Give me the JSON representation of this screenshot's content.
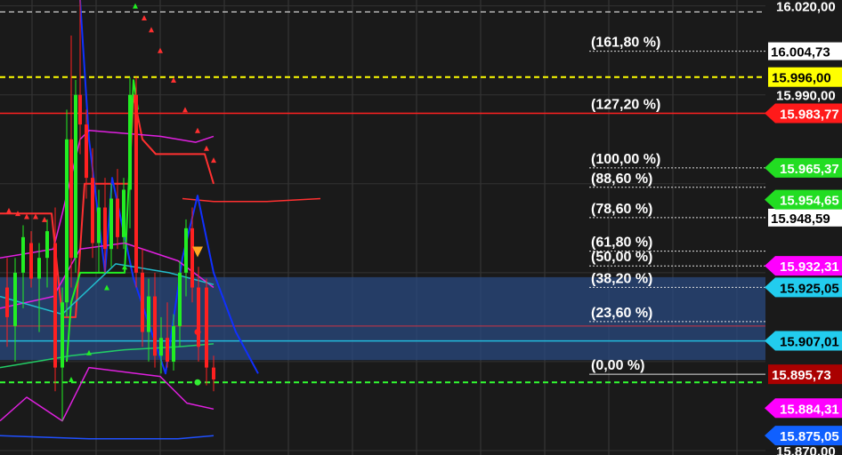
{
  "chart_data": {
    "type": "line",
    "title": "",
    "y_axis_side": "right",
    "grid": true,
    "background": "#1a1a1a",
    "ylim": [
      15868.5,
      16022.0
    ],
    "y_ticks": [
      {
        "label": "16.020,00",
        "value": 16020.0
      },
      {
        "label": "15.990,00",
        "value": 15990.0
      },
      {
        "label": "15.870,00",
        "value": 15870.0
      }
    ],
    "fibonacci_levels": [
      {
        "label": "(161,80 %)",
        "value": 16004.73,
        "price_label": "16.004,73"
      },
      {
        "label": "(127,20 %)",
        "value": 15983.77
      },
      {
        "label": "(100,00 %)",
        "value": 15965.37
      },
      {
        "label": "(88,60 %)",
        "value": 15958.8
      },
      {
        "label": "(78,60 %)",
        "value": 15948.59,
        "price_label": "15.948,59"
      },
      {
        "label": "(61,80 %)",
        "value": 15937.25
      },
      {
        "label": "(50,00 %)",
        "value": 15932.3
      },
      {
        "label": "(38,20 %)",
        "value": 15925.05
      },
      {
        "label": "(23,60 %)",
        "value": 15913.5
      },
      {
        "label": "(0,00 %)",
        "value": 15895.73
      }
    ],
    "price_markers": [
      {
        "label": "15.996,00",
        "value": 15996.0,
        "bg": "#ffff00",
        "fg": "#000000",
        "shape": "rect"
      },
      {
        "label": "15.983,77",
        "value": 15983.77,
        "bg": "#ff1a1a",
        "fg": "#ffffff",
        "shape": "arrow"
      },
      {
        "label": "15.965,37",
        "value": 15965.37,
        "bg": "#22dd22",
        "fg": "#ffffff",
        "shape": "arrow"
      },
      {
        "label": "15.954,65",
        "value": 15954.65,
        "bg": "#22dd22",
        "fg": "#ffffff",
        "shape": "arrow"
      },
      {
        "label": "15.932,31",
        "value": 15932.31,
        "bg": "#ff00ff",
        "fg": "#ffffff",
        "shape": "arrow"
      },
      {
        "label": "15.925,05",
        "value": 15925.05,
        "bg": "#22ccee",
        "fg": "#000000",
        "shape": "arrow"
      },
      {
        "label": "15.907,01",
        "value": 15907.01,
        "bg": "#22ccee",
        "fg": "#000000",
        "shape": "arrow"
      },
      {
        "label": "15.895,73",
        "value": 15895.73,
        "bg": "#aa0000",
        "fg": "#ffffff",
        "shape": "rect"
      },
      {
        "label": "15.884,31",
        "value": 15884.31,
        "bg": "#ff00ff",
        "fg": "#ffffff",
        "shape": "arrow"
      },
      {
        "label": "15.875,05",
        "value": 15875.05,
        "bg": "#1060ff",
        "fg": "#ffffff",
        "shape": "arrow"
      }
    ],
    "horizontal_lines": [
      {
        "name": "yellow-dashed",
        "value": 15996.0,
        "color": "#ffff00",
        "dash": true
      },
      {
        "name": "red-level",
        "value": 15983.77,
        "color": "#ff2020",
        "dash": false
      },
      {
        "name": "support-dashed",
        "value": 15893.0,
        "color": "#33ff33",
        "dash": true
      }
    ],
    "zone": {
      "from": 15900.5,
      "to": 15928.5,
      "color": "#2a4a80"
    },
    "candles": [
      {
        "x": 8,
        "o": 15925,
        "h": 15935,
        "l": 15905,
        "c": 15915
      },
      {
        "x": 17,
        "o": 15912,
        "h": 15935,
        "l": 15900,
        "c": 15930
      },
      {
        "x": 26,
        "o": 15930,
        "h": 15946,
        "l": 15918,
        "c": 15942
      },
      {
        "x": 35,
        "o": 15940,
        "h": 15944,
        "l": 15925,
        "c": 15928
      },
      {
        "x": 44,
        "o": 15928,
        "h": 15940,
        "l": 15910,
        "c": 15935
      },
      {
        "x": 53,
        "o": 15935,
        "h": 15948,
        "l": 15925,
        "c": 15944
      },
      {
        "x": 62,
        "o": 15940,
        "h": 15952,
        "l": 15890,
        "c": 15898
      },
      {
        "x": 70,
        "o": 15898,
        "h": 15925,
        "l": 15880,
        "c": 15920
      },
      {
        "x": 75,
        "o": 15920,
        "h": 15985,
        "l": 15915,
        "c": 15975
      },
      {
        "x": 80,
        "o": 15975,
        "h": 16010,
        "l": 15925,
        "c": 15935
      },
      {
        "x": 85,
        "o": 15935,
        "h": 15995,
        "l": 15930,
        "c": 15990
      },
      {
        "x": 90,
        "o": 15990,
        "h": 16022,
        "l": 15970,
        "c": 15980
      },
      {
        "x": 97,
        "o": 15980,
        "h": 15985,
        "l": 15955,
        "c": 15962
      },
      {
        "x": 104,
        "o": 15962,
        "h": 15972,
        "l": 15935,
        "c": 15940
      },
      {
        "x": 111,
        "o": 15940,
        "h": 15958,
        "l": 15930,
        "c": 15952
      },
      {
        "x": 118,
        "o": 15952,
        "h": 15962,
        "l": 15930,
        "c": 15938
      },
      {
        "x": 125,
        "o": 15938,
        "h": 15960,
        "l": 15932,
        "c": 15955
      },
      {
        "x": 132,
        "o": 15955,
        "h": 15965,
        "l": 15938,
        "c": 15942
      },
      {
        "x": 139,
        "o": 15942,
        "h": 15962,
        "l": 15938,
        "c": 15958
      },
      {
        "x": 146,
        "o": 15958,
        "h": 15996,
        "l": 15945,
        "c": 15990
      },
      {
        "x": 153,
        "o": 15990,
        "h": 15996,
        "l": 15925,
        "c": 15930
      },
      {
        "x": 160,
        "o": 15930,
        "h": 15938,
        "l": 15905,
        "c": 15910
      },
      {
        "x": 167,
        "o": 15910,
        "h": 15928,
        "l": 15900,
        "c": 15922
      },
      {
        "x": 174,
        "o": 15922,
        "h": 15930,
        "l": 15898,
        "c": 15902
      },
      {
        "x": 181,
        "o": 15902,
        "h": 15915,
        "l": 15896,
        "c": 15908
      },
      {
        "x": 188,
        "o": 15908,
        "h": 15920,
        "l": 15898,
        "c": 15900
      },
      {
        "x": 195,
        "o": 15900,
        "h": 15916,
        "l": 15897,
        "c": 15912
      },
      {
        "x": 202,
        "o": 15912,
        "h": 15934,
        "l": 15905,
        "c": 15930
      },
      {
        "x": 209,
        "o": 15930,
        "h": 15948,
        "l": 15922,
        "c": 15945
      },
      {
        "x": 216,
        "o": 15945,
        "h": 15952,
        "l": 15920,
        "c": 15925
      },
      {
        "x": 223,
        "o": 15925,
        "h": 15932,
        "l": 15900,
        "c": 15905
      },
      {
        "x": 232,
        "o": 15925,
        "h": 15928,
        "l": 15892,
        "c": 15898
      },
      {
        "x": 240,
        "o": 15898,
        "h": 15902,
        "l": 15890,
        "c": 15894
      }
    ],
    "series": [
      {
        "name": "",
        "color": "#ff3030",
        "width": 2,
        "points": [
          [
            0,
            15950
          ],
          [
            58,
            15950
          ],
          [
            70,
            15915
          ],
          [
            85,
            15915
          ],
          [
            95,
            15960
          ],
          [
            130,
            15960
          ],
          [
            145,
            15960
          ],
          [
            150,
            15990
          ],
          [
            160,
            15975
          ],
          [
            175,
            15970
          ],
          [
            185,
            15970
          ],
          [
            195,
            15970
          ],
          [
            230,
            15970
          ],
          [
            240,
            15960
          ]
        ]
      },
      {
        "name": "",
        "color": "#ff3030",
        "width": 1.5,
        "points": [
          [
            205,
            15955
          ],
          [
            240,
            15954
          ],
          [
            300,
            15954
          ],
          [
            360,
            15955
          ]
        ]
      },
      {
        "name": "",
        "color": "#1030ff",
        "width": 2,
        "points": [
          [
            90,
            16022
          ],
          [
            100,
            15975
          ],
          [
            118,
            15930
          ],
          [
            126,
            15962
          ],
          [
            150,
            15928
          ],
          [
            168,
            15912
          ],
          [
            186,
            15896
          ],
          [
            205,
            15935
          ],
          [
            222,
            15956
          ],
          [
            240,
            15930
          ],
          [
            265,
            15910
          ],
          [
            290,
            15896
          ]
        ]
      },
      {
        "name": "",
        "color": "#22ee22",
        "width": 2,
        "points": [
          [
            75,
            15900
          ],
          [
            80,
            15920
          ],
          [
            90,
            15930
          ],
          [
            140,
            15930
          ],
          [
            150,
            15995
          ],
          [
            155,
            15985
          ]
        ]
      },
      {
        "name": "",
        "color": "#e020e0",
        "width": 1.5,
        "points": [
          [
            0,
            15935
          ],
          [
            60,
            15938
          ],
          [
            70,
            15950
          ],
          [
            90,
            15975
          ],
          [
            100,
            15978
          ],
          [
            180,
            15976
          ],
          [
            220,
            15974
          ],
          [
            240,
            15976
          ]
        ]
      },
      {
        "name": "",
        "color": "#e020e0",
        "width": 1.5,
        "points": [
          [
            0,
            15918
          ],
          [
            60,
            15922
          ],
          [
            90,
            15938
          ],
          [
            140,
            15940
          ],
          [
            200,
            15934
          ],
          [
            240,
            15925
          ]
        ]
      },
      {
        "name": "",
        "color": "#e020e0",
        "width": 1.5,
        "points": [
          [
            0,
            15880
          ],
          [
            30,
            15888
          ],
          [
            70,
            15880
          ],
          [
            100,
            15898
          ],
          [
            180,
            15895
          ],
          [
            210,
            15886
          ],
          [
            240,
            15884
          ]
        ]
      },
      {
        "name": "",
        "color": "#22bbcc",
        "width": 1.5,
        "points": [
          [
            0,
            15922
          ],
          [
            70,
            15916
          ],
          [
            130,
            15933
          ],
          [
            190,
            15930
          ],
          [
            240,
            15926
          ]
        ]
      },
      {
        "name": "",
        "color": "#22cc66",
        "width": 1.5,
        "points": [
          [
            0,
            15898
          ],
          [
            80,
            15902
          ],
          [
            140,
            15904
          ],
          [
            200,
            15905
          ],
          [
            240,
            15906
          ]
        ]
      },
      {
        "name": "",
        "color": "#2050ff",
        "width": 1.5,
        "points": [
          [
            0,
            15875
          ],
          [
            100,
            15874
          ],
          [
            200,
            15874
          ],
          [
            240,
            15875
          ]
        ]
      }
    ],
    "triangle_markers": [
      {
        "x": 152,
        "y": 16020,
        "color": "#22ee22",
        "dir": "up"
      },
      {
        "x": 162,
        "y": 16016,
        "color": "#ff3030",
        "dir": "up"
      },
      {
        "x": 170,
        "y": 16012,
        "color": "#ff3030",
        "dir": "up"
      },
      {
        "x": 180,
        "y": 16005,
        "color": "#ff3030",
        "dir": "up"
      },
      {
        "x": 195,
        "y": 15995,
        "color": "#ff3030",
        "dir": "up"
      },
      {
        "x": 208,
        "y": 15985,
        "color": "#ff3030",
        "dir": "up"
      },
      {
        "x": 222,
        "y": 15978,
        "color": "#ff3030",
        "dir": "up"
      },
      {
        "x": 232,
        "y": 15972,
        "color": "#ff3030",
        "dir": "up"
      },
      {
        "x": 240,
        "y": 15968,
        "color": "#ff3030",
        "dir": "up"
      },
      {
        "x": 10,
        "y": 15951,
        "color": "#ff3030",
        "dir": "up"
      },
      {
        "x": 20,
        "y": 15950,
        "color": "#ff3030",
        "dir": "up"
      },
      {
        "x": 30,
        "y": 15949,
        "color": "#ff3030",
        "dir": "up"
      },
      {
        "x": 40,
        "y": 15949,
        "color": "#ff3030",
        "dir": "up"
      },
      {
        "x": 50,
        "y": 15948,
        "color": "#ff3030",
        "dir": "up"
      },
      {
        "x": 120,
        "y": 15925,
        "color": "#22ee22",
        "dir": "up"
      },
      {
        "x": 140,
        "y": 15932,
        "color": "#22ee22",
        "dir": "up"
      },
      {
        "x": 100,
        "y": 15903,
        "color": "#22ee22",
        "dir": "up"
      },
      {
        "x": 80,
        "y": 15894,
        "color": "#22ee22",
        "dir": "up"
      },
      {
        "x": 222,
        "y": 15937,
        "color": "#ffaa22",
        "dir": "down"
      }
    ],
    "dot_markers": [
      {
        "x": 222,
        "y": 15910,
        "color": "#ff2020"
      },
      {
        "x": 222,
        "y": 15893,
        "color": "#33ee33"
      }
    ]
  }
}
